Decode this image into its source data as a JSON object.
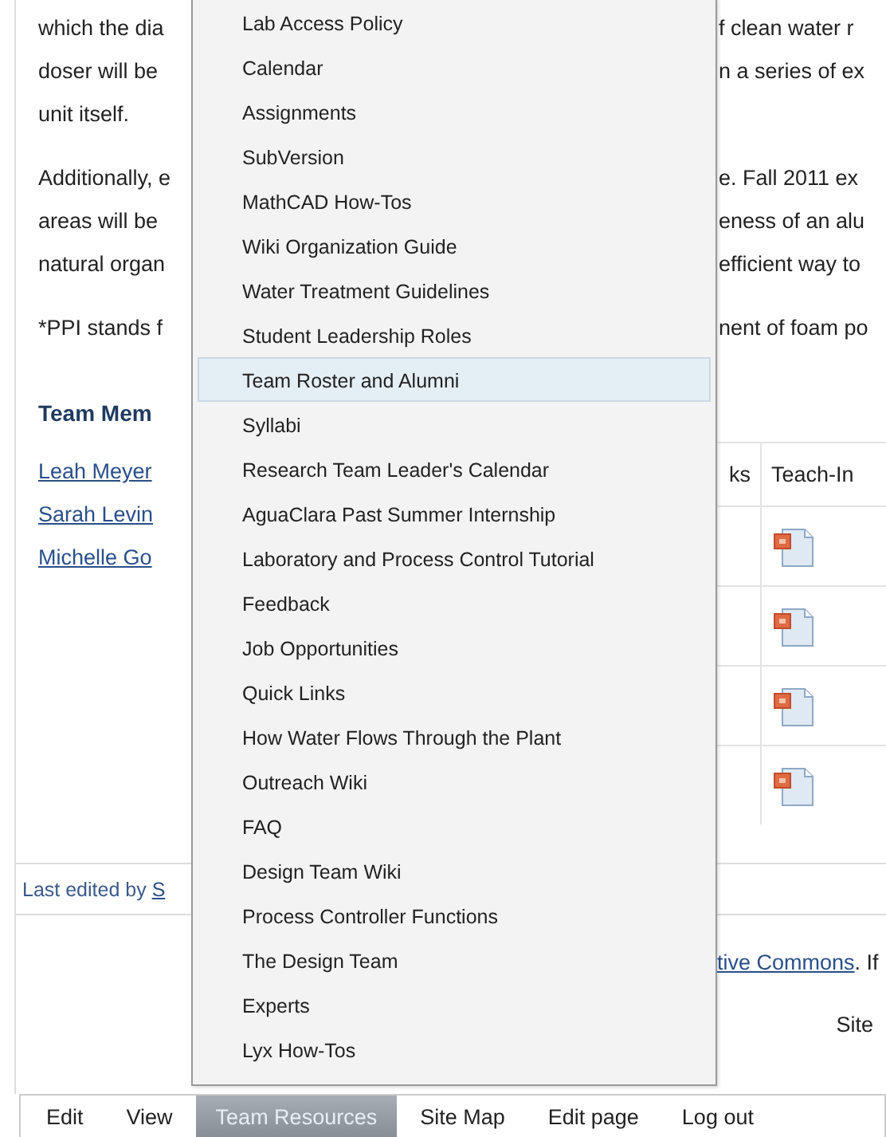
{
  "article": {
    "paragraphs": [
      {
        "lines": [
          {
            "left": "which the dia",
            "right": "f clean water r"
          },
          {
            "left": "doser will be",
            "right": "n a series of ex"
          },
          {
            "left": "unit itself."
          }
        ]
      },
      {
        "lines": [
          {
            "left": "Additionally, e",
            "right": "e. Fall 2011 ex"
          },
          {
            "left": "areas will be",
            "right": "eness of an alu"
          },
          {
            "left": "natural organ",
            "right": "efficient way to"
          }
        ]
      },
      {
        "lines": [
          {
            "left": "*PPI stands f",
            "right": "nent of foam po"
          }
        ]
      }
    ]
  },
  "team": {
    "heading": "Team Mem",
    "members": [
      "Leah Meyer",
      "Sarah Levin",
      "Michelle Go"
    ]
  },
  "table": {
    "columns": [
      "ks",
      "Teach-In"
    ],
    "rows": [
      {
        "kind": "file"
      },
      {
        "kind": "file"
      },
      {
        "kind": "file"
      },
      {
        "kind": "file"
      }
    ]
  },
  "footer": {
    "last_edited": "Last edited by ",
    "editor_link": "S",
    "license_link": "tive Commons",
    "license_text": ". If",
    "site": "Site"
  },
  "menu": {
    "items": [
      {
        "label": "Lab Access Policy",
        "selected": false
      },
      {
        "label": "Calendar",
        "selected": false
      },
      {
        "label": "Assignments",
        "selected": false
      },
      {
        "label": "SubVersion",
        "selected": false
      },
      {
        "label": "MathCAD How-Tos",
        "selected": false
      },
      {
        "label": "Wiki Organization Guide",
        "selected": false
      },
      {
        "label": "Water Treatment Guidelines",
        "selected": false
      },
      {
        "label": "Student Leadership Roles",
        "selected": false
      },
      {
        "label": "Team Roster and Alumni",
        "selected": true
      },
      {
        "label": "Syllabi",
        "selected": false
      },
      {
        "label": "Research Team Leader's Calendar",
        "selected": false
      },
      {
        "label": "AguaClara Past Summer Internship",
        "selected": false
      },
      {
        "label": "Laboratory and Process Control Tutorial",
        "selected": false
      },
      {
        "label": "Feedback",
        "selected": false
      },
      {
        "label": "Job Opportunities",
        "selected": false
      },
      {
        "label": "Quick Links",
        "selected": false
      },
      {
        "label": "How Water Flows Through the Plant",
        "selected": false
      },
      {
        "label": "Outreach Wiki",
        "selected": false
      },
      {
        "label": "FAQ",
        "selected": false
      },
      {
        "label": "Design Team Wiki",
        "selected": false
      },
      {
        "label": "Process Controller Functions",
        "selected": false
      },
      {
        "label": "The Design Team",
        "selected": false
      },
      {
        "label": "Experts",
        "selected": false
      },
      {
        "label": "Lyx How-Tos",
        "selected": false
      }
    ]
  },
  "nav": [
    {
      "label": "Edit",
      "selected": false
    },
    {
      "label": "View",
      "selected": false
    },
    {
      "label": "Team Resources",
      "selected": true
    },
    {
      "label": "Site Map",
      "selected": false
    },
    {
      "label": "Edit page",
      "selected": false
    },
    {
      "label": "Log out",
      "selected": false
    }
  ]
}
